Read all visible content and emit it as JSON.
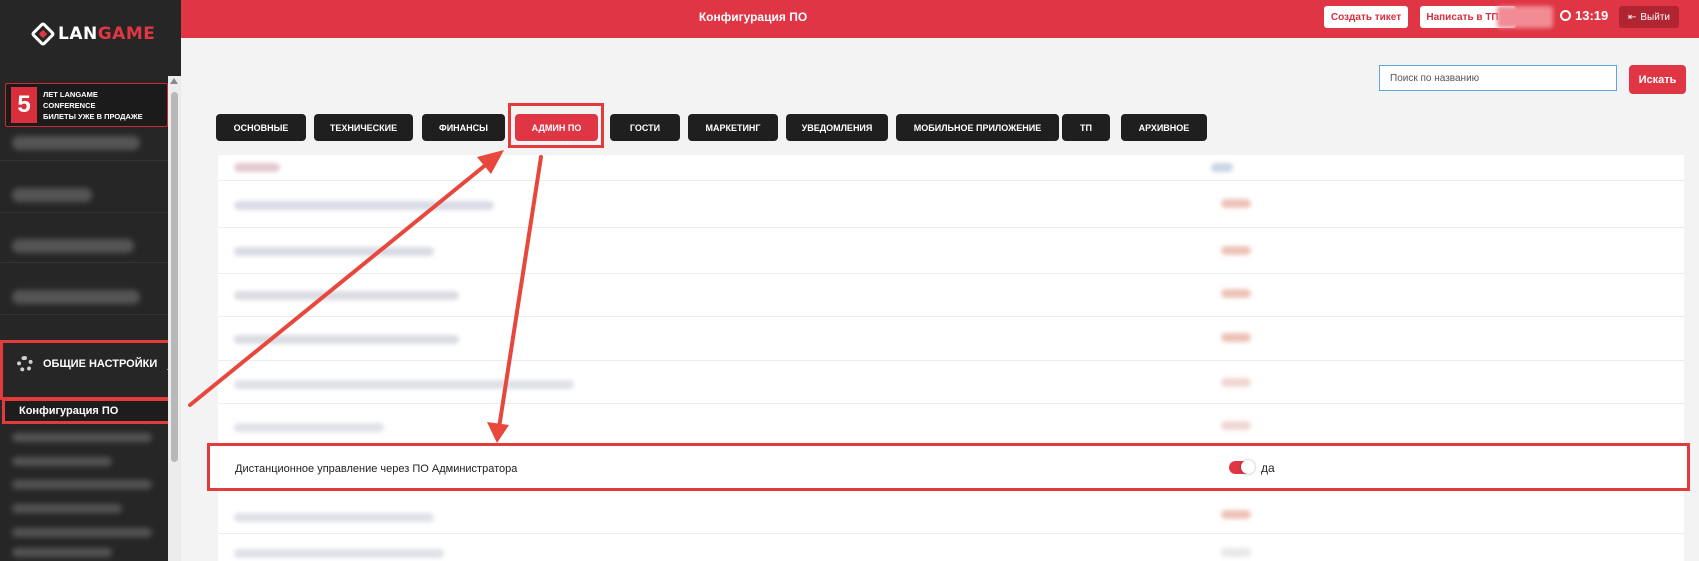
{
  "brand": {
    "logo_text_a": "LAN",
    "logo_text_b": "GAME",
    "accent": "#df3544"
  },
  "promo": {
    "number": "5",
    "line1": "ЛЕТ LANGAME",
    "line2": "CONFERENCE",
    "line3": "БИЛЕТЫ УЖЕ В ПРОДАЖЕ"
  },
  "sidebar": {
    "general_settings": "ОБЩИЕ НАСТРОЙКИ",
    "active_subitem": "Конфигурация ПО"
  },
  "header": {
    "title": "Конфигурация ПО",
    "create_ticket": "Создать тикет",
    "write_support": "Написать в ТП",
    "time": "13:19",
    "logout": "Выйти"
  },
  "search": {
    "placeholder": "Поиск по названию",
    "button": "Искать"
  },
  "tabs": [
    {
      "label": "ОСНОВНЫЕ"
    },
    {
      "label": "ТЕХНИЧЕСКИЕ"
    },
    {
      "label": "ФИНАНСЫ"
    },
    {
      "label": "АДМИН ПО",
      "active": true
    },
    {
      "label": "ГОСТИ"
    },
    {
      "label": "МАРКЕТИНГ"
    },
    {
      "label": "УВЕДОМЛЕНИЯ"
    },
    {
      "label": "МОБИЛЬНОЕ ПРИЛОЖЕНИЕ"
    },
    {
      "label": "ТП"
    },
    {
      "label": "АРХИВНОЕ"
    }
  ],
  "highlighted_setting": {
    "label": "Дистанционное управление через ПО Администратора",
    "toggle_on": true,
    "value": "да"
  }
}
